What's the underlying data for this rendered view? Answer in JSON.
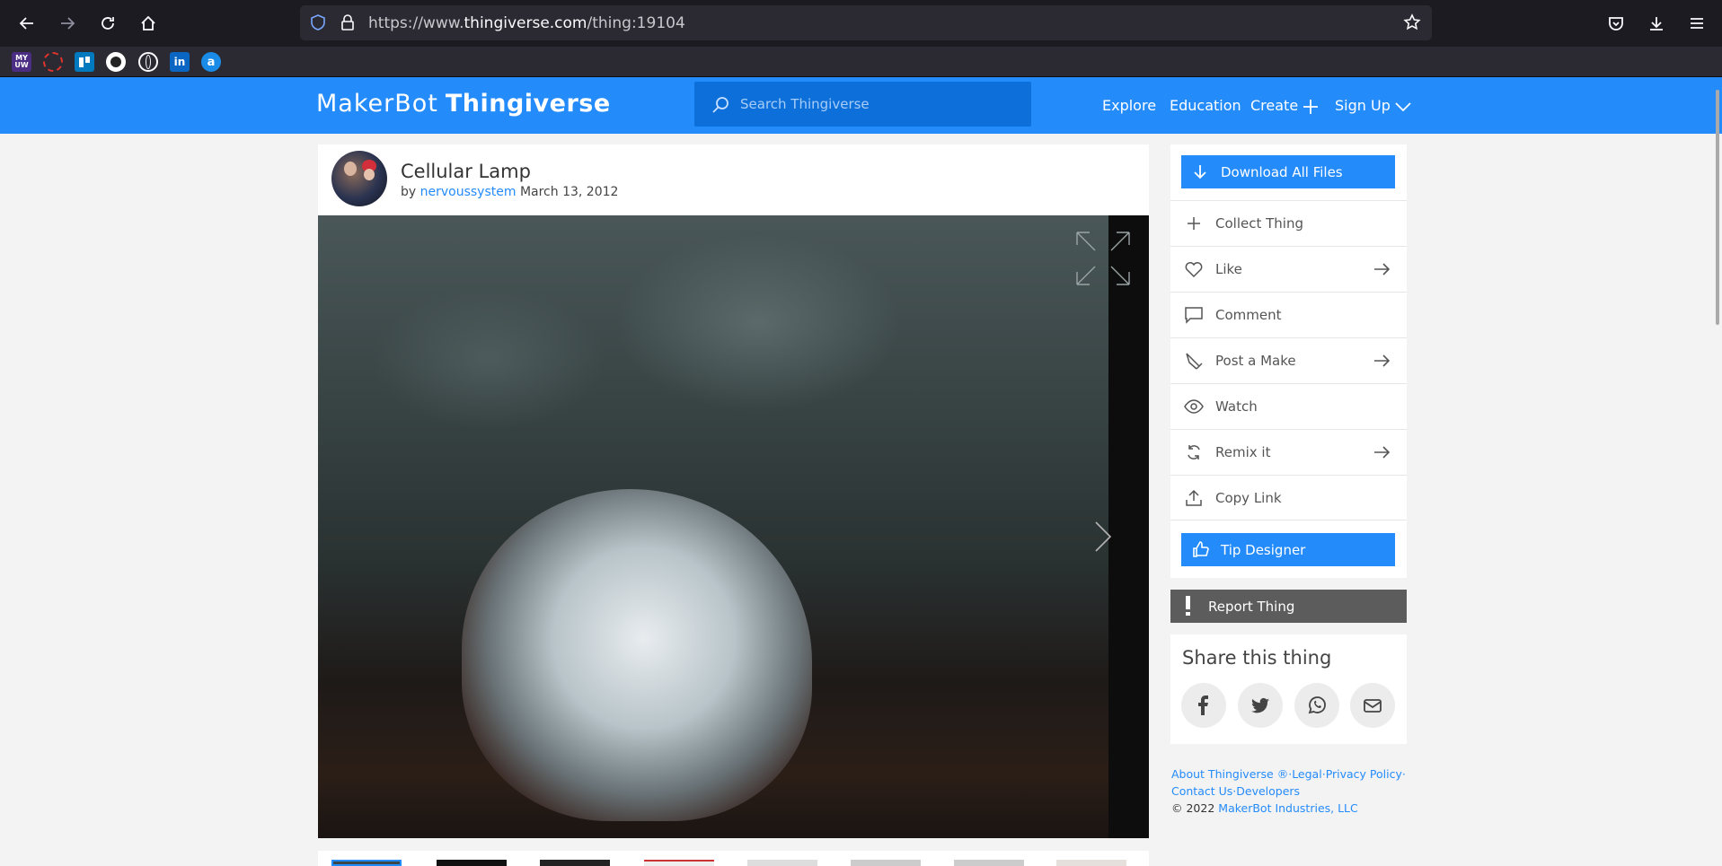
{
  "browser": {
    "url_prefix": "https://www.",
    "url_domain": "thingiverse.com",
    "url_path": "/thing:19104",
    "bookmarks": [
      "myuw-icon",
      "circle-icon",
      "trello-icon",
      "github-icon",
      "globe-icon",
      "linkedin-icon",
      "link-icon"
    ]
  },
  "header": {
    "logo_makerbot": "MakerBot",
    "logo_thingiverse": "Thingiverse",
    "search_placeholder": "Search Thingiverse",
    "nav": {
      "explore": "Explore",
      "education": "Education",
      "create": "Create",
      "signup": "Sign Up"
    }
  },
  "thing": {
    "title": "Cellular Lamp",
    "by": "by",
    "author": "nervoussystem",
    "date": "March 13, 2012"
  },
  "actions": {
    "download": "Download All Files",
    "collect": "Collect Thing",
    "like": "Like",
    "comment": "Comment",
    "post_make": "Post a Make",
    "watch": "Watch",
    "remix": "Remix it",
    "copy_link": "Copy Link",
    "tip": "Tip Designer",
    "report": "Report Thing"
  },
  "share": {
    "heading": "Share this thing"
  },
  "footer": {
    "about": "About Thingiverse ®",
    "legal": "Legal",
    "privacy": "Privacy Policy",
    "contact": "Contact Us",
    "developers": "Developers",
    "copyright": "©  2022",
    "company": "MakerBot Industries, LLC"
  }
}
